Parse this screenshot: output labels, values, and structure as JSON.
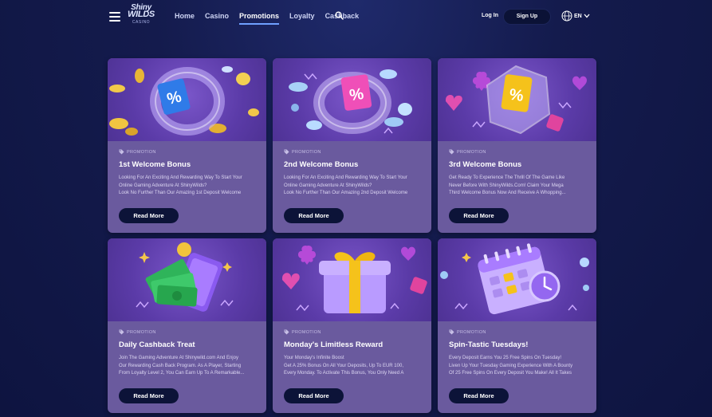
{
  "header": {
    "logo": {
      "line1": "Shiny",
      "line2": "WILDS",
      "line3": "CASINO"
    },
    "nav": [
      {
        "label": "Home"
      },
      {
        "label": "Casino"
      },
      {
        "label": "Promotions",
        "active": true
      },
      {
        "label": "Loyalty"
      },
      {
        "label": "Cashback"
      }
    ],
    "login_label": "Log In",
    "signup_label": "Sign Up",
    "language": "EN"
  },
  "cards": [
    {
      "tag": "PROMOTION",
      "title": "1st Welcome Bonus",
      "desc_lines": [
        "Looking For An Exciting And Rewarding Way To Start Your",
        "Online Gaming Adventure At ShinyWilds?",
        "Look No Further Than Our Amazing 1st Deposit Welcome"
      ],
      "button": "Read More",
      "icon": "percent-tag-ring-icon",
      "tag_color": "#2f7be8"
    },
    {
      "tag": "PROMOTION",
      "title": "2nd Welcome Bonus",
      "desc_lines": [
        "Looking For An Exciting And Rewarding Way To Start Your",
        "Online Gaming Adventure At ShinyWilds?",
        "Look No Further Than Our Amazing 2nd Deposit Welcome"
      ],
      "button": "Read More",
      "icon": "percent-tag-ring-icon",
      "tag_color": "#ef4fb8"
    },
    {
      "tag": "PROMOTION",
      "title": "3rd Welcome Bonus",
      "desc_lines": [
        "Get Ready To Experience The Thrill Of The Game Like",
        "Never Before With ShinyWilds.Com! Claim Your Mega",
        "Third Welcome Bonus Now And Receive A Whopping..."
      ],
      "button": "Read More",
      "icon": "percent-tag-hexagon-icon",
      "tag_color": "#f5c21b"
    },
    {
      "tag": "PROMOTION",
      "title": "Daily Cashback Treat",
      "desc_lines": [
        "Join The Gaming Adventure At Shinywild.com And Enjoy",
        "Our Rewarding Cash Back Program. As A Player, Starting",
        "From Loyalty Level 2, You Can Earn Up To A Remarkable..."
      ],
      "button": "Read More",
      "icon": "cash-phone-icon"
    },
    {
      "tag": "PROMOTION",
      "title": "Monday's Limitless Reward",
      "desc_lines": [
        "Your Monday's Infinite Boost",
        "Get A 25% Bonus On All Your Deposits, Up To EUR 100,",
        "Every Monday. To Activate This Bonus, You Only Need A"
      ],
      "button": "Read More",
      "icon": "gift-box-icon"
    },
    {
      "tag": "PROMOTION",
      "title": "Spin-Tastic Tuesdays!",
      "desc_lines": [
        "Every Deposit Earns You 25 Free Spins On Tuesday!",
        "Liven Up Your Tuesday Gaming Experience With A Bounty",
        "Of 25 Free Spins On Every Deposit You Make! All It Takes"
      ],
      "button": "Read More",
      "icon": "calendar-clock-icon"
    }
  ]
}
